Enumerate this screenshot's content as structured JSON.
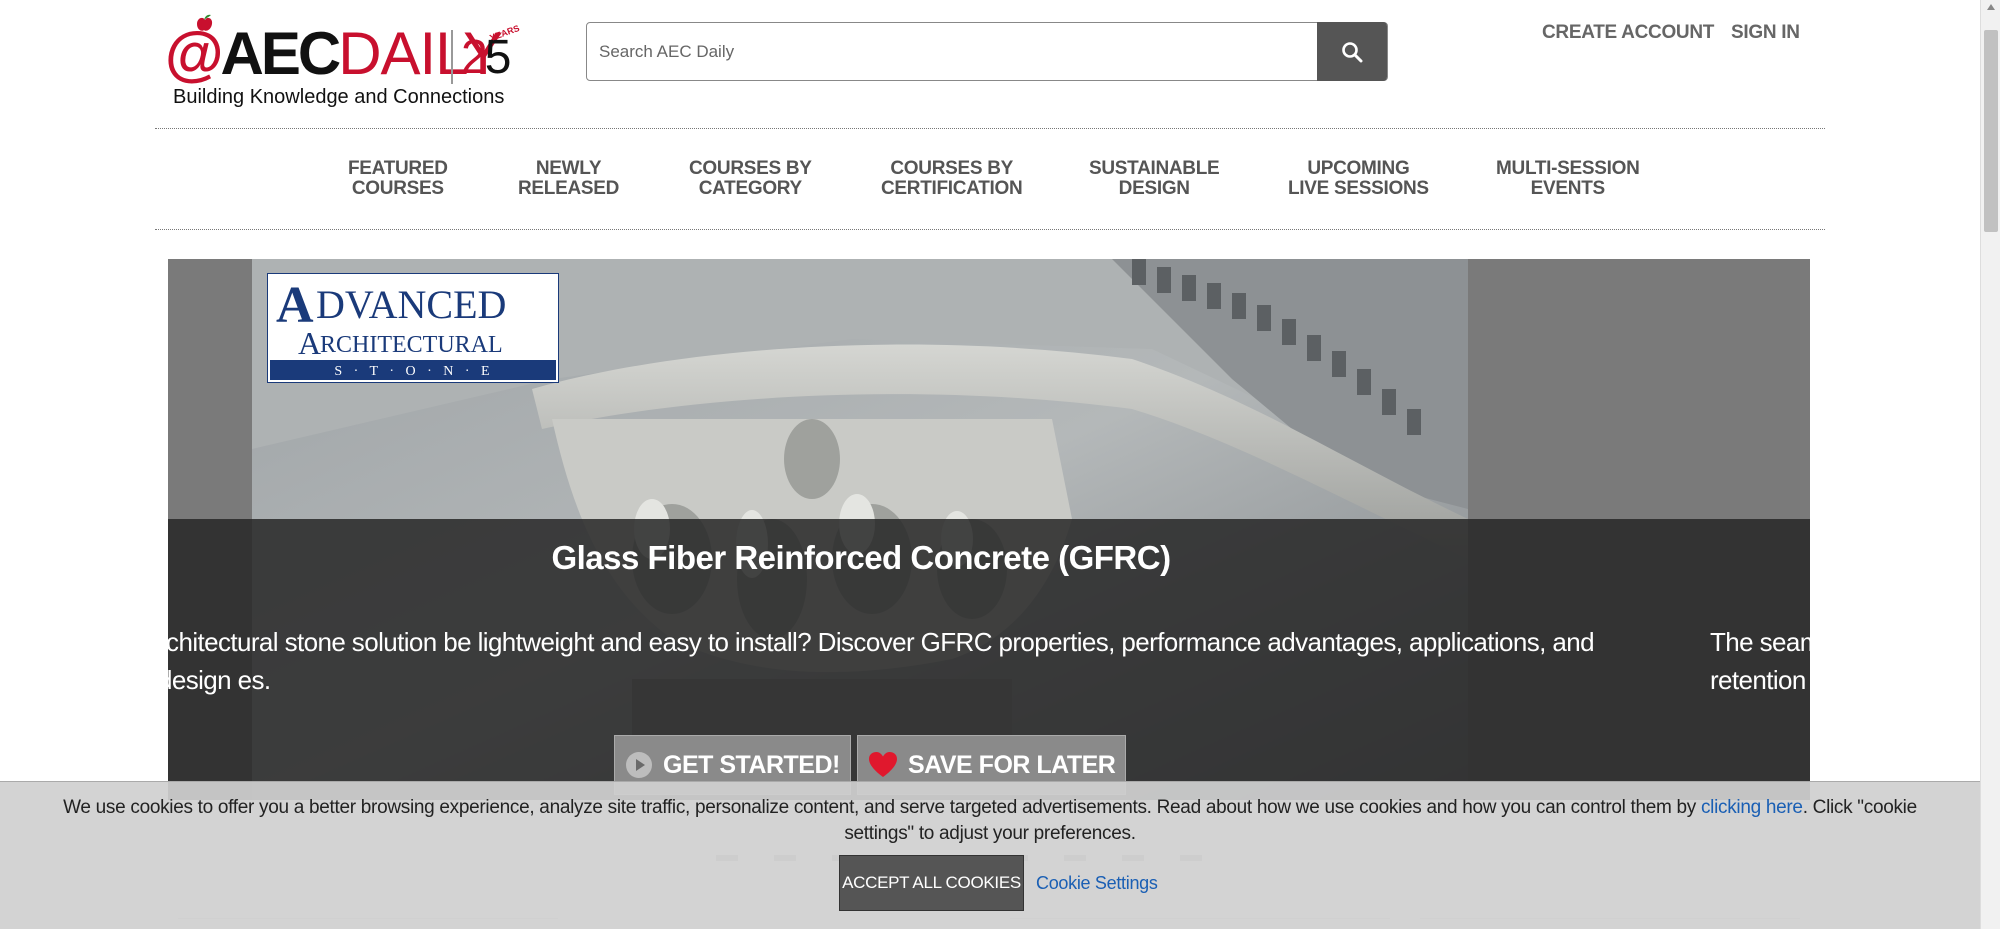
{
  "header": {
    "logo": {
      "at": "@",
      "aec": "AEC",
      "daily": "DAILY",
      "anniversary_two": "2",
      "anniversary_five": "5",
      "anniversary_years": "YEARS",
      "tagline": "Building Knowledge and Connections"
    },
    "search": {
      "placeholder": "Search AEC Daily",
      "button_icon": "search-icon"
    },
    "create_account": "CREATE ACCOUNT",
    "sign_in": "SIGN IN"
  },
  "nav": {
    "items": [
      {
        "line1": "FEATURED",
        "line2": "COURSES"
      },
      {
        "line1": "NEWLY",
        "line2": "RELEASED"
      },
      {
        "line1": "COURSES BY",
        "line2": "CATEGORY"
      },
      {
        "line1": "COURSES BY",
        "line2": "CERTIFICATION"
      },
      {
        "line1": "SUSTAINABLE",
        "line2": "DESIGN"
      },
      {
        "line1": "UPCOMING",
        "line2": "LIVE SESSIONS"
      },
      {
        "line1": "MULTI-SESSION",
        "line2": "EVENTS"
      }
    ]
  },
  "hero": {
    "sponsor_logo": {
      "line1_big": "A",
      "line1_rest": "DVANCED",
      "line2_big": "A",
      "line2_rest": "RCHITECTURAL",
      "line3": "S · T · O · N · E"
    },
    "title": "Glass Fiber Reinforced Concrete (GFRC)",
    "description": "rchitectural stone solution be lightweight and easy to install? Discover GFRC properties, performance advantages, applications, and design es.",
    "next_description_line1": "The seam",
    "next_description_line2": "retention",
    "get_started_label": "GET STARTED!",
    "save_later_label": "SAVE FOR LATER",
    "colors": {
      "overlay": "#282828",
      "button": "#8a8a8a",
      "heart": "#e0182d"
    }
  },
  "cookie_bar": {
    "icon": "info-icon",
    "icon_glyph": "",
    "text_before": "We use cookies to offer you a better browsing experience, analyze site traffic, personalize content, and serve targeted advertisements. Read about how we use cookies and how you can control them by ",
    "link_text": "clicking here",
    "text_after": ". Click \"cookie settings\" to adjust your preferences.",
    "accept_label": "ACCEPT ALL COOKIES",
    "settings_label": "Cookie Settings"
  },
  "colors": {
    "brand_red": "#c8102e",
    "link_blue": "#1a5fb4",
    "nav_text": "#555555"
  }
}
